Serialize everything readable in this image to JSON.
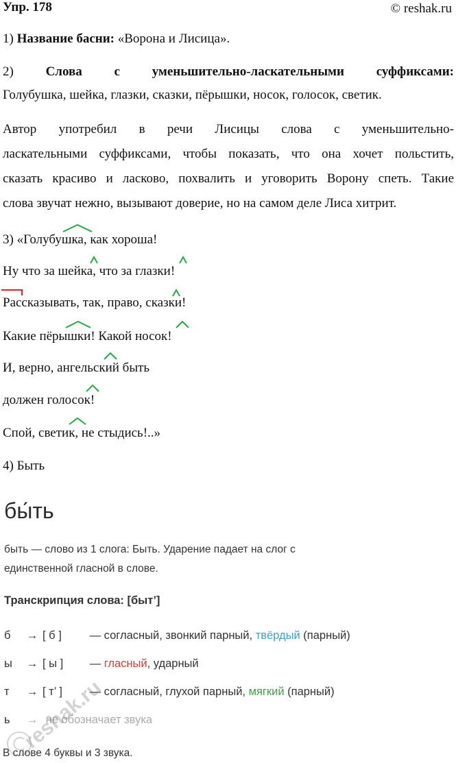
{
  "header": {
    "title": "Упр. 178",
    "copyright": "© reshak.ru"
  },
  "item1": {
    "num": "1)",
    "label": "Название басни:",
    "value": "«Ворона и Лисица»."
  },
  "item2": {
    "num": "2)",
    "label_words": [
      "Слова",
      "с",
      "уменьшительно-ласкательными",
      "суффиксами:"
    ],
    "words": "Голубушка, шейка, глазки, сказки, пёрышки, носок, голосок, светик."
  },
  "paragraph": {
    "lines": [
      "Автор употребил в речи Лисицы слова с уменьшительно-",
      "ласкательными суффиксами, чтобы показать, что она хочет польстить,",
      "сказать красиво и ласково, похвалить и уговорить Ворону спеть. Такие",
      "слова звучат нежно, вызывают доверие, но на самом деле Лиса хитрит."
    ]
  },
  "poem": {
    "lines": [
      "3) «Голубушка, как хороша!",
      "Ну что за шейка, что за глазки!",
      "Рассказывать, так, право, сказки!",
      "Какие пёрышки! Какой носок!",
      "И, верно, ангельский быть",
      "должен голосок!",
      "Спой, светик, не стыдись!..»"
    ]
  },
  "item4": {
    "text": "4) Быть"
  },
  "phonetic": {
    "word": "бы́ть",
    "description_lines": [
      "быть — слово из 1 слога: Быть. Ударение падает на слог с",
      "единственной гласной в слове."
    ],
    "transcription_label": "Транскрипция слова: [быт’]",
    "rows": [
      {
        "letter": "б",
        "arrow": "→",
        "sound": "[ б ]",
        "desc1": "— согласный, звонкий парный,",
        "hl": "твёрдый",
        "desc2": "(парный)"
      },
      {
        "letter": "ы",
        "arrow": "→",
        "sound": "[ ы ]",
        "desc1": "—",
        "hl": "гласный",
        "desc2": ", ударный"
      },
      {
        "letter": "т",
        "arrow": "→",
        "sound": "[ т’ ]",
        "desc1": "— согласный, глухой парный,",
        "hl": "мягкий",
        "desc2": "(парный)"
      },
      {
        "letter": "ь",
        "arrow": "→",
        "sound": "",
        "desc1": "не обозначает звука",
        "hl": "",
        "desc2": ""
      }
    ],
    "summary": "В слове 4 буквы и 3 звука."
  },
  "watermark": {
    "text": "reshak.ru"
  },
  "colors": {
    "suffix_mark": "#22aa44",
    "prefix_mark": "#dd2222",
    "hard": "#3aa0d8",
    "vowel": "#e53935",
    "soft": "#43a047"
  }
}
